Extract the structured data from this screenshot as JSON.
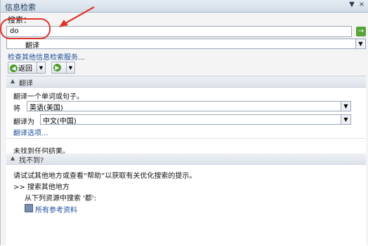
{
  "pane": {
    "title": "信息检索",
    "menu_glyph": "▼",
    "close_glyph": "×"
  },
  "search": {
    "label": "搜索：",
    "value": "do",
    "go_glyph": "→",
    "service": "翻译",
    "other_services_link": "检查其他信息检索服务..."
  },
  "toolbar": {
    "back_label": "返回",
    "back_glyph": "◀",
    "forward_glyph": "▶",
    "drop_glyph": "▼"
  },
  "translate": {
    "header": "翻译",
    "prompt": "翻译一个单词或句子。",
    "from_label": "将",
    "from_value": "英语(美国)",
    "to_label": "翻译为",
    "to_value": "中文(中国)",
    "options_link": "翻译选项...",
    "no_result": "未找到任何结果。"
  },
  "not_found": {
    "header": "找不到?",
    "hint": "请试试其他地方或查看“帮助”以获取有关优化搜索的提示。",
    "search_other": ">> 搜索其他地方",
    "from_sources": "从下列资源中搜索 '都':",
    "all_refs_link": "所有参考资料"
  },
  "icons": {
    "collapse": "▲",
    "dropdown": "▼"
  },
  "colors": {
    "annotation": "#e0332b",
    "link": "#1f4f9b",
    "go_button": "#58a33a"
  }
}
